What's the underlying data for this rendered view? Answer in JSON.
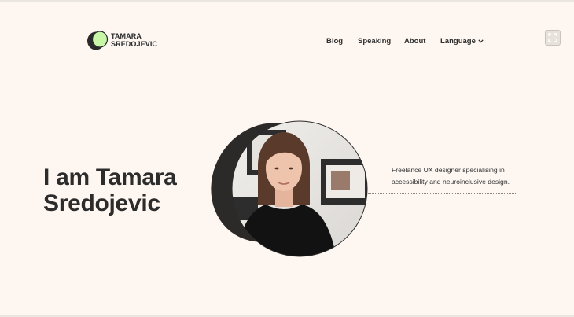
{
  "logo": {
    "line1": "TAMARA",
    "line2": "SREDOJEVIC",
    "accent_color": "#c8f7a7",
    "dark_color": "#2a2a2a"
  },
  "nav": {
    "items": [
      {
        "label": "Blog"
      },
      {
        "label": "Speaking"
      },
      {
        "label": "About"
      }
    ],
    "language_label": "Language",
    "language_icon": "chevron-down-icon"
  },
  "toolbar": {
    "fullscreen_icon": "fullscreen-icon"
  },
  "hero": {
    "title_line1": "I am Tamara",
    "title_line2": "Sredojevic",
    "tagline_line1": "Freelance UX designer specialising in",
    "tagline_line2": "accessibility and neuroinclusive design.",
    "portrait_alt": "Portrait photo of Tamara Sredojevic",
    "shadow_color": "#2c2a29",
    "background_color": "#fdf6f1"
  }
}
